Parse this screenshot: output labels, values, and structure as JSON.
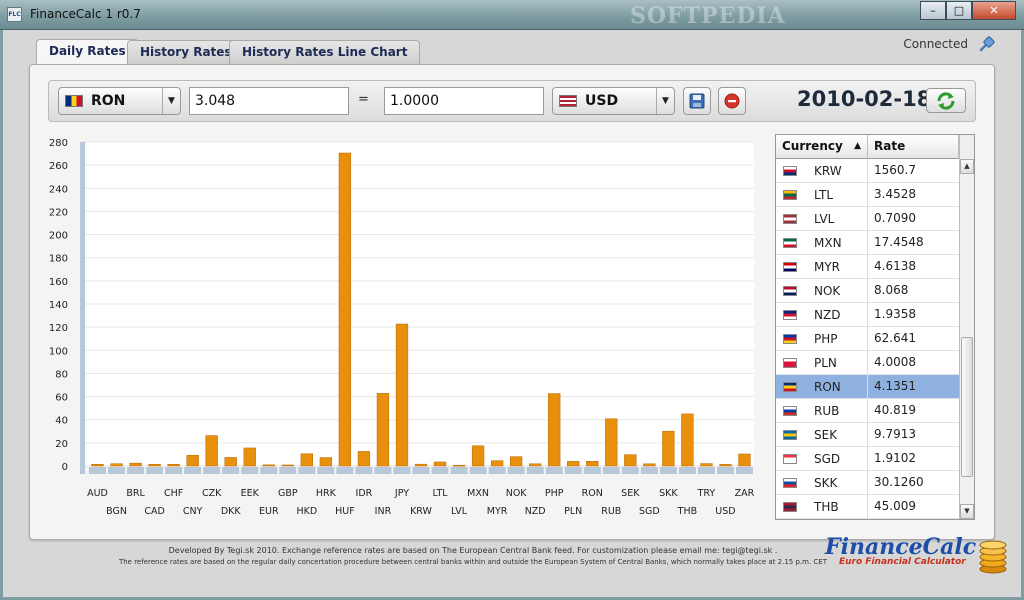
{
  "window": {
    "title": "FinanceCalc 1 r0.7",
    "background_word": "SOFTPEDIA",
    "icon_text": "FLC"
  },
  "tabs": [
    {
      "label": "Daily Rates",
      "active": true
    },
    {
      "label": "History Rates",
      "active": false
    },
    {
      "label": "History Rates Line Chart",
      "active": false
    }
  ],
  "status": {
    "label": "Connected",
    "icon": "plug-icon"
  },
  "converter": {
    "from_currency": "RON",
    "from_amount": "3.048",
    "equals": "=",
    "to_amount": "1.0000",
    "to_currency": "USD",
    "date": "2010-02-18",
    "buttons": [
      "save-icon",
      "cancel-icon",
      "refresh-icon"
    ]
  },
  "colors": {
    "bar": "#e8900c",
    "bar_base": "#b8c8d8",
    "selected_row": "#8fb1e0",
    "brand_blue": "#1c4ea8",
    "brand_red": "#c9301c"
  },
  "chart_data": {
    "type": "bar",
    "title": "",
    "xlabel": "",
    "ylabel": "",
    "ylim": [
      0,
      280
    ],
    "y_ticks": [
      0,
      20,
      40,
      60,
      80,
      100,
      120,
      140,
      160,
      180,
      200,
      220,
      240,
      260,
      280
    ],
    "grid": true,
    "categories": [
      "AUD",
      "BGN",
      "BRL",
      "CAD",
      "CHF",
      "CNY",
      "CZK",
      "DKK",
      "EEK",
      "EUR",
      "GBP",
      "HKD",
      "HRK",
      "HUF",
      "IDR",
      "INR",
      "JPY",
      "KRW",
      "LTL",
      "LVL",
      "MXN",
      "MYR",
      "NOK",
      "NZD",
      "PHP",
      "PLN",
      "RON",
      "RUB",
      "SEK",
      "SGD",
      "SKK",
      "THB",
      "TRY",
      "USD",
      "ZAR"
    ],
    "values": [
      1.5,
      2.0,
      2.5,
      1.5,
      1.5,
      9.3,
      26.3,
      7.4,
      15.6,
      1.0,
      0.9,
      10.6,
      7.3,
      270.5,
      12.6,
      62.8,
      122.7,
      1.6,
      3.5,
      0.7,
      17.5,
      4.6,
      8.1,
      1.9,
      62.6,
      4.0,
      4.1,
      40.8,
      9.8,
      1.9,
      30.1,
      45.0,
      2.1,
      1.4,
      10.4
    ]
  },
  "table": {
    "headers": {
      "currency": "Currency",
      "rate": "Rate",
      "sort_indicator": "▲"
    },
    "rows": [
      {
        "code": "KRW",
        "rate": "1560.7",
        "flag": [
          "#ffffff",
          "#c60c30",
          "#003478"
        ]
      },
      {
        "code": "LTL",
        "rate": "3.4528",
        "flag": [
          "#fdb913",
          "#006a44",
          "#c1272d"
        ]
      },
      {
        "code": "LVL",
        "rate": "0.7090",
        "flag": [
          "#9e3039",
          "#ffffff",
          "#9e3039"
        ]
      },
      {
        "code": "MXN",
        "rate": "17.4548",
        "flag": [
          "#006847",
          "#ffffff",
          "#ce1126"
        ]
      },
      {
        "code": "MYR",
        "rate": "4.6138",
        "flag": [
          "#cc0001",
          "#ffffff",
          "#010066"
        ]
      },
      {
        "code": "NOK",
        "rate": "8.068",
        "flag": [
          "#ba0c2f",
          "#ffffff",
          "#00205b"
        ]
      },
      {
        "code": "NZD",
        "rate": "1.9358",
        "flag": [
          "#00247d",
          "#cc142b",
          "#ffffff"
        ]
      },
      {
        "code": "PHP",
        "rate": "62.641",
        "flag": [
          "#0038a8",
          "#ce1126",
          "#fcd116"
        ]
      },
      {
        "code": "PLN",
        "rate": "4.0008",
        "flag": [
          "#ffffff",
          "#dc143c",
          "#dc143c"
        ]
      },
      {
        "code": "RON",
        "rate": "4.1351",
        "flag": [
          "#002b7f",
          "#fcd116",
          "#ce1126"
        ],
        "selected": true
      },
      {
        "code": "RUB",
        "rate": "40.819",
        "flag": [
          "#ffffff",
          "#0039a6",
          "#d52b1e"
        ]
      },
      {
        "code": "SEK",
        "rate": "9.7913",
        "flag": [
          "#006aa7",
          "#fecc00",
          "#006aa7"
        ]
      },
      {
        "code": "SGD",
        "rate": "1.9102",
        "flag": [
          "#ef3340",
          "#ffffff",
          "#ffffff"
        ]
      },
      {
        "code": "SKK",
        "rate": "30.1260",
        "flag": [
          "#ffffff",
          "#0b4ea2",
          "#ee1c25"
        ]
      },
      {
        "code": "THB",
        "rate": "45.009",
        "flag": [
          "#a51931",
          "#2d2a4a",
          "#a51931"
        ]
      }
    ]
  },
  "footer": {
    "line1": "Developed By Tegi.sk 2010. Exchange reference rates are based on The European Central Bank feed. For customization please email me: tegi@tegi.sk .",
    "line2": "The reference rates are based on the regular daily concertation procedure between central banks within and outside the European System of Central Banks, which normally takes place at 2.15 p.m. CET"
  },
  "logo": {
    "name": "FinanceCalc",
    "tagline": "Euro Financial Calculator"
  }
}
